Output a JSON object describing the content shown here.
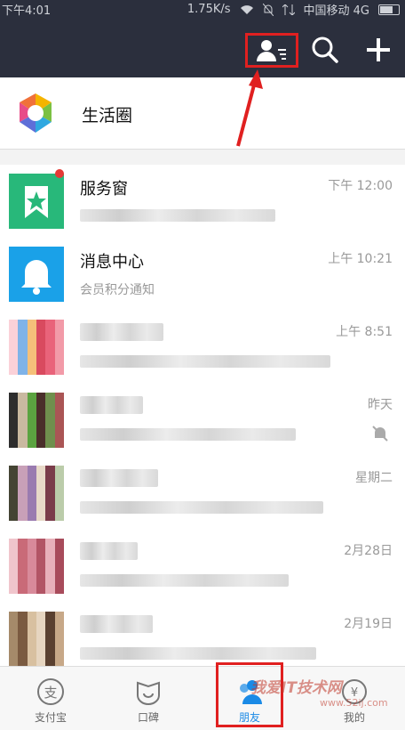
{
  "status_bar": {
    "time": "下午4:01",
    "speed": "1.75K/s",
    "carrier": "中国移动 4G"
  },
  "life_circle": {
    "label": "生活圈"
  },
  "conversations": [
    {
      "title": "服务窗",
      "subtitle": "",
      "time": "下午 12:00",
      "avatar": "star-icon",
      "unread": true,
      "color": "#28b87a"
    },
    {
      "title": "消息中心",
      "subtitle": "会员积分通知",
      "time": "上午 10:21",
      "avatar": "bell-icon",
      "unread": false,
      "color": "#1aa1e8"
    },
    {
      "title": "",
      "subtitle": "",
      "time": "上午 8:51",
      "avatar": "pixel-avatar",
      "unread": false
    },
    {
      "title": "",
      "subtitle": "",
      "time": "昨天",
      "avatar": "pixel-avatar",
      "unread": false,
      "muted": true
    },
    {
      "title": "",
      "subtitle": "",
      "time": "星期二",
      "avatar": "pixel-avatar",
      "unread": false
    },
    {
      "title": "",
      "subtitle": "",
      "time": "2月28日",
      "avatar": "pixel-avatar",
      "unread": false
    },
    {
      "title": "",
      "subtitle": "",
      "time": "2月19日",
      "avatar": "pixel-avatar",
      "unread": false
    }
  ],
  "tabs": [
    {
      "label": "支付宝",
      "icon": "alipay-icon",
      "active": false
    },
    {
      "label": "口碑",
      "icon": "koubei-icon",
      "active": false
    },
    {
      "label": "朋友",
      "icon": "friends-icon",
      "active": true
    },
    {
      "label": "我的",
      "icon": "me-icon",
      "active": false
    }
  ],
  "watermark": {
    "text": "我爱IT技术网",
    "url": "www.52ij.com"
  },
  "colors": {
    "header": "#2b2f3d",
    "accent": "#1a8ae6",
    "annotation": "#e02020"
  }
}
